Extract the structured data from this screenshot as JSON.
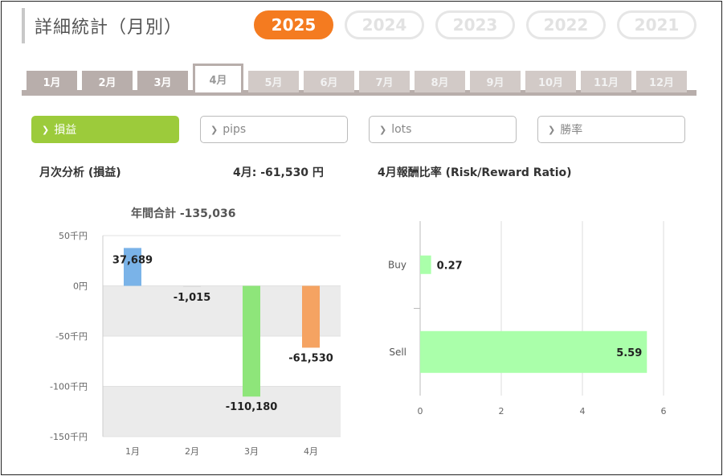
{
  "page": {
    "title": "詳細統計（月別）"
  },
  "years": [
    {
      "label": "2025",
      "active": true
    },
    {
      "label": "2024",
      "active": false
    },
    {
      "label": "2023",
      "active": false
    },
    {
      "label": "2022",
      "active": false
    },
    {
      "label": "2021",
      "active": false
    }
  ],
  "months": [
    {
      "label": "1月",
      "state": "normal"
    },
    {
      "label": "2月",
      "state": "normal"
    },
    {
      "label": "3月",
      "state": "normal"
    },
    {
      "label": "4月",
      "state": "active"
    },
    {
      "label": "5月",
      "state": "dim"
    },
    {
      "label": "6月",
      "state": "dim"
    },
    {
      "label": "7月",
      "state": "dim"
    },
    {
      "label": "8月",
      "state": "dim"
    },
    {
      "label": "9月",
      "state": "dim"
    },
    {
      "label": "10月",
      "state": "dim"
    },
    {
      "label": "11月",
      "state": "dim"
    },
    {
      "label": "12月",
      "state": "dim"
    }
  ],
  "metrics": [
    {
      "label": "損益",
      "active": true
    },
    {
      "label": "pips",
      "active": false
    },
    {
      "label": "lots",
      "active": false
    },
    {
      "label": "勝率",
      "active": false
    }
  ],
  "monthly": {
    "heading": "月次分析 (損益)",
    "summary": "4月:  -61,530 円",
    "total_label": "年間合計 -135,036"
  },
  "ratio": {
    "heading": "4月報酬比率 (Risk/Reward Ratio)"
  },
  "chart_data": [
    {
      "type": "bar",
      "title": "年間合計 -135,036",
      "categories": [
        "1月",
        "2月",
        "3月",
        "4月"
      ],
      "values": [
        37689,
        -1015,
        -110180,
        -61530
      ],
      "value_labels": [
        "37,689",
        "-1,015",
        "-110,180",
        "-61,530"
      ],
      "colors": [
        "#7ab3e8",
        "#dddddd",
        "#8ee57a",
        "#f5a362"
      ],
      "ylim": [
        -150000,
        50000
      ],
      "ticks": [
        {
          "value": 50000,
          "label": "50千円"
        },
        {
          "value": 0,
          "label": "0円"
        },
        {
          "value": -50000,
          "label": "-50千円"
        },
        {
          "value": -100000,
          "label": "-100千円"
        },
        {
          "value": -150000,
          "label": "-150千円"
        }
      ],
      "grid": true,
      "band_color": "#ebebeb"
    },
    {
      "type": "bar",
      "orientation": "horizontal",
      "title": "4月報酬比率 (Risk/Reward Ratio)",
      "categories": [
        "Buy",
        "Sell"
      ],
      "values": [
        0.27,
        5.59
      ],
      "value_labels": [
        "0.27",
        "5.59"
      ],
      "color": "#aaffaa",
      "xlim": [
        0,
        6
      ],
      "ticks": [
        "0",
        "2",
        "4",
        "6"
      ],
      "grid": true
    }
  ]
}
